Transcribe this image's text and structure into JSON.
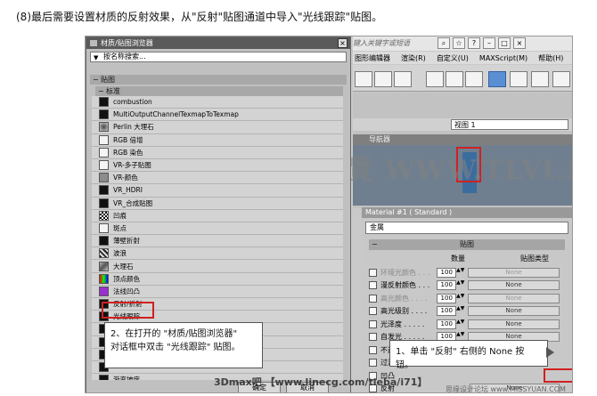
{
  "caption": "(8)最后需要设置材质的反射效果，从\"反射\"贴图通道中导入\"光线跟踪\"贴图。",
  "background_window": {
    "search_placeholder": "键入关键字或短语",
    "menus": [
      "图形编辑器",
      "渲染(R)",
      "自定义(U)",
      "MAXScript(M)",
      "帮助(H)"
    ],
    "viewport_select": "视图 1",
    "viewport_label": "导航器"
  },
  "material_editor": {
    "title": "Material #1 ( Standard )",
    "material_name": "金属",
    "rollout_title": "贴图",
    "col_amount": "数量",
    "col_map_type": "贴图类型",
    "rows": [
      {
        "label": "环境光颜色 . . .",
        "amount": "100",
        "map": "None",
        "dim": true
      },
      {
        "label": "漫反射颜色 . . .",
        "amount": "100",
        "map": "None",
        "dim": false
      },
      {
        "label": "高光颜色 . . . .",
        "amount": "100",
        "map": "None",
        "dim": true
      },
      {
        "label": "高光级别 . . . .",
        "amount": "100",
        "map": "None",
        "dim": false
      },
      {
        "label": "光泽度 . . . . .",
        "amount": "100",
        "map": "None",
        "dim": false
      },
      {
        "label": "自发光 . . . . .",
        "amount": "100",
        "map": "None",
        "dim": false
      },
      {
        "label": "不透",
        "amount": "",
        "map": "",
        "dim": false
      },
      {
        "label": "过滤",
        "amount": "",
        "map": "",
        "dim": false
      },
      {
        "label": "凹凸",
        "amount": "",
        "map": "",
        "dim": false
      },
      {
        "label": "反射",
        "amount": "",
        "map": "None",
        "dim": false
      }
    ]
  },
  "browser_dialog": {
    "title": "材质/贴图浏览器",
    "search_placeholder": "按名称搜索...",
    "group_maps": "贴图",
    "group_standard": "标准",
    "items": [
      {
        "label": "combustion",
        "swatch": "black"
      },
      {
        "label": "MultiOutputChannelTexmapToTexmap",
        "swatch": "black"
      },
      {
        "label": "Perlin 大理石",
        "swatch": "perlin"
      },
      {
        "label": "RGB 倍增",
        "swatch": "white"
      },
      {
        "label": "RGB 染色",
        "swatch": "white"
      },
      {
        "label": "VR-多子贴图",
        "swatch": "white"
      },
      {
        "label": "VR-颜色",
        "swatch": "gray"
      },
      {
        "label": "VR_HDRI",
        "swatch": "black"
      },
      {
        "label": "VR_合成贴图",
        "swatch": "black"
      },
      {
        "label": "凹痕",
        "swatch": "checker"
      },
      {
        "label": "斑点",
        "swatch": "white"
      },
      {
        "label": "薄壁折射",
        "swatch": "black"
      },
      {
        "label": "波浪",
        "swatch": "waves"
      },
      {
        "label": "大理石",
        "swatch": "marble"
      },
      {
        "label": "顶点颜色",
        "swatch": "vertex"
      },
      {
        "label": "法线凹凸",
        "swatch": "purple"
      },
      {
        "label": "反射/折射",
        "swatch": "black"
      },
      {
        "label": "光线跟踪",
        "swatch": "black"
      },
      {
        "label": "",
        "swatch": "black"
      },
      {
        "label": "",
        "swatch": "black"
      },
      {
        "label": "",
        "swatch": "black"
      },
      {
        "label": "",
        "swatch": "black"
      },
      {
        "label": "渐变坡度",
        "swatch": "black"
      }
    ],
    "ok_label": "确定",
    "cancel_label": "取消"
  },
  "callouts": {
    "left_line1": "2、在打开的 \"材质/贴图浏览器\"",
    "left_line2": "对话框中双击 \"光线跟踪\" 贴图。",
    "right": "1、单击 \"反射\" 右侧的 None 按钮。"
  },
  "watermarks": {
    "center": "腾龍視覺 WWW.TLVI.NET",
    "footer": "3Dmax吧 【www.linecg.com/tieba/i71】",
    "footer2": "思缘设计论坛 www.MISSYUAN.COM"
  },
  "colors": {
    "highlight_red": "#d02020",
    "dialog_bg": "#c0c0c0",
    "title_bar": "#5a5a5a"
  }
}
